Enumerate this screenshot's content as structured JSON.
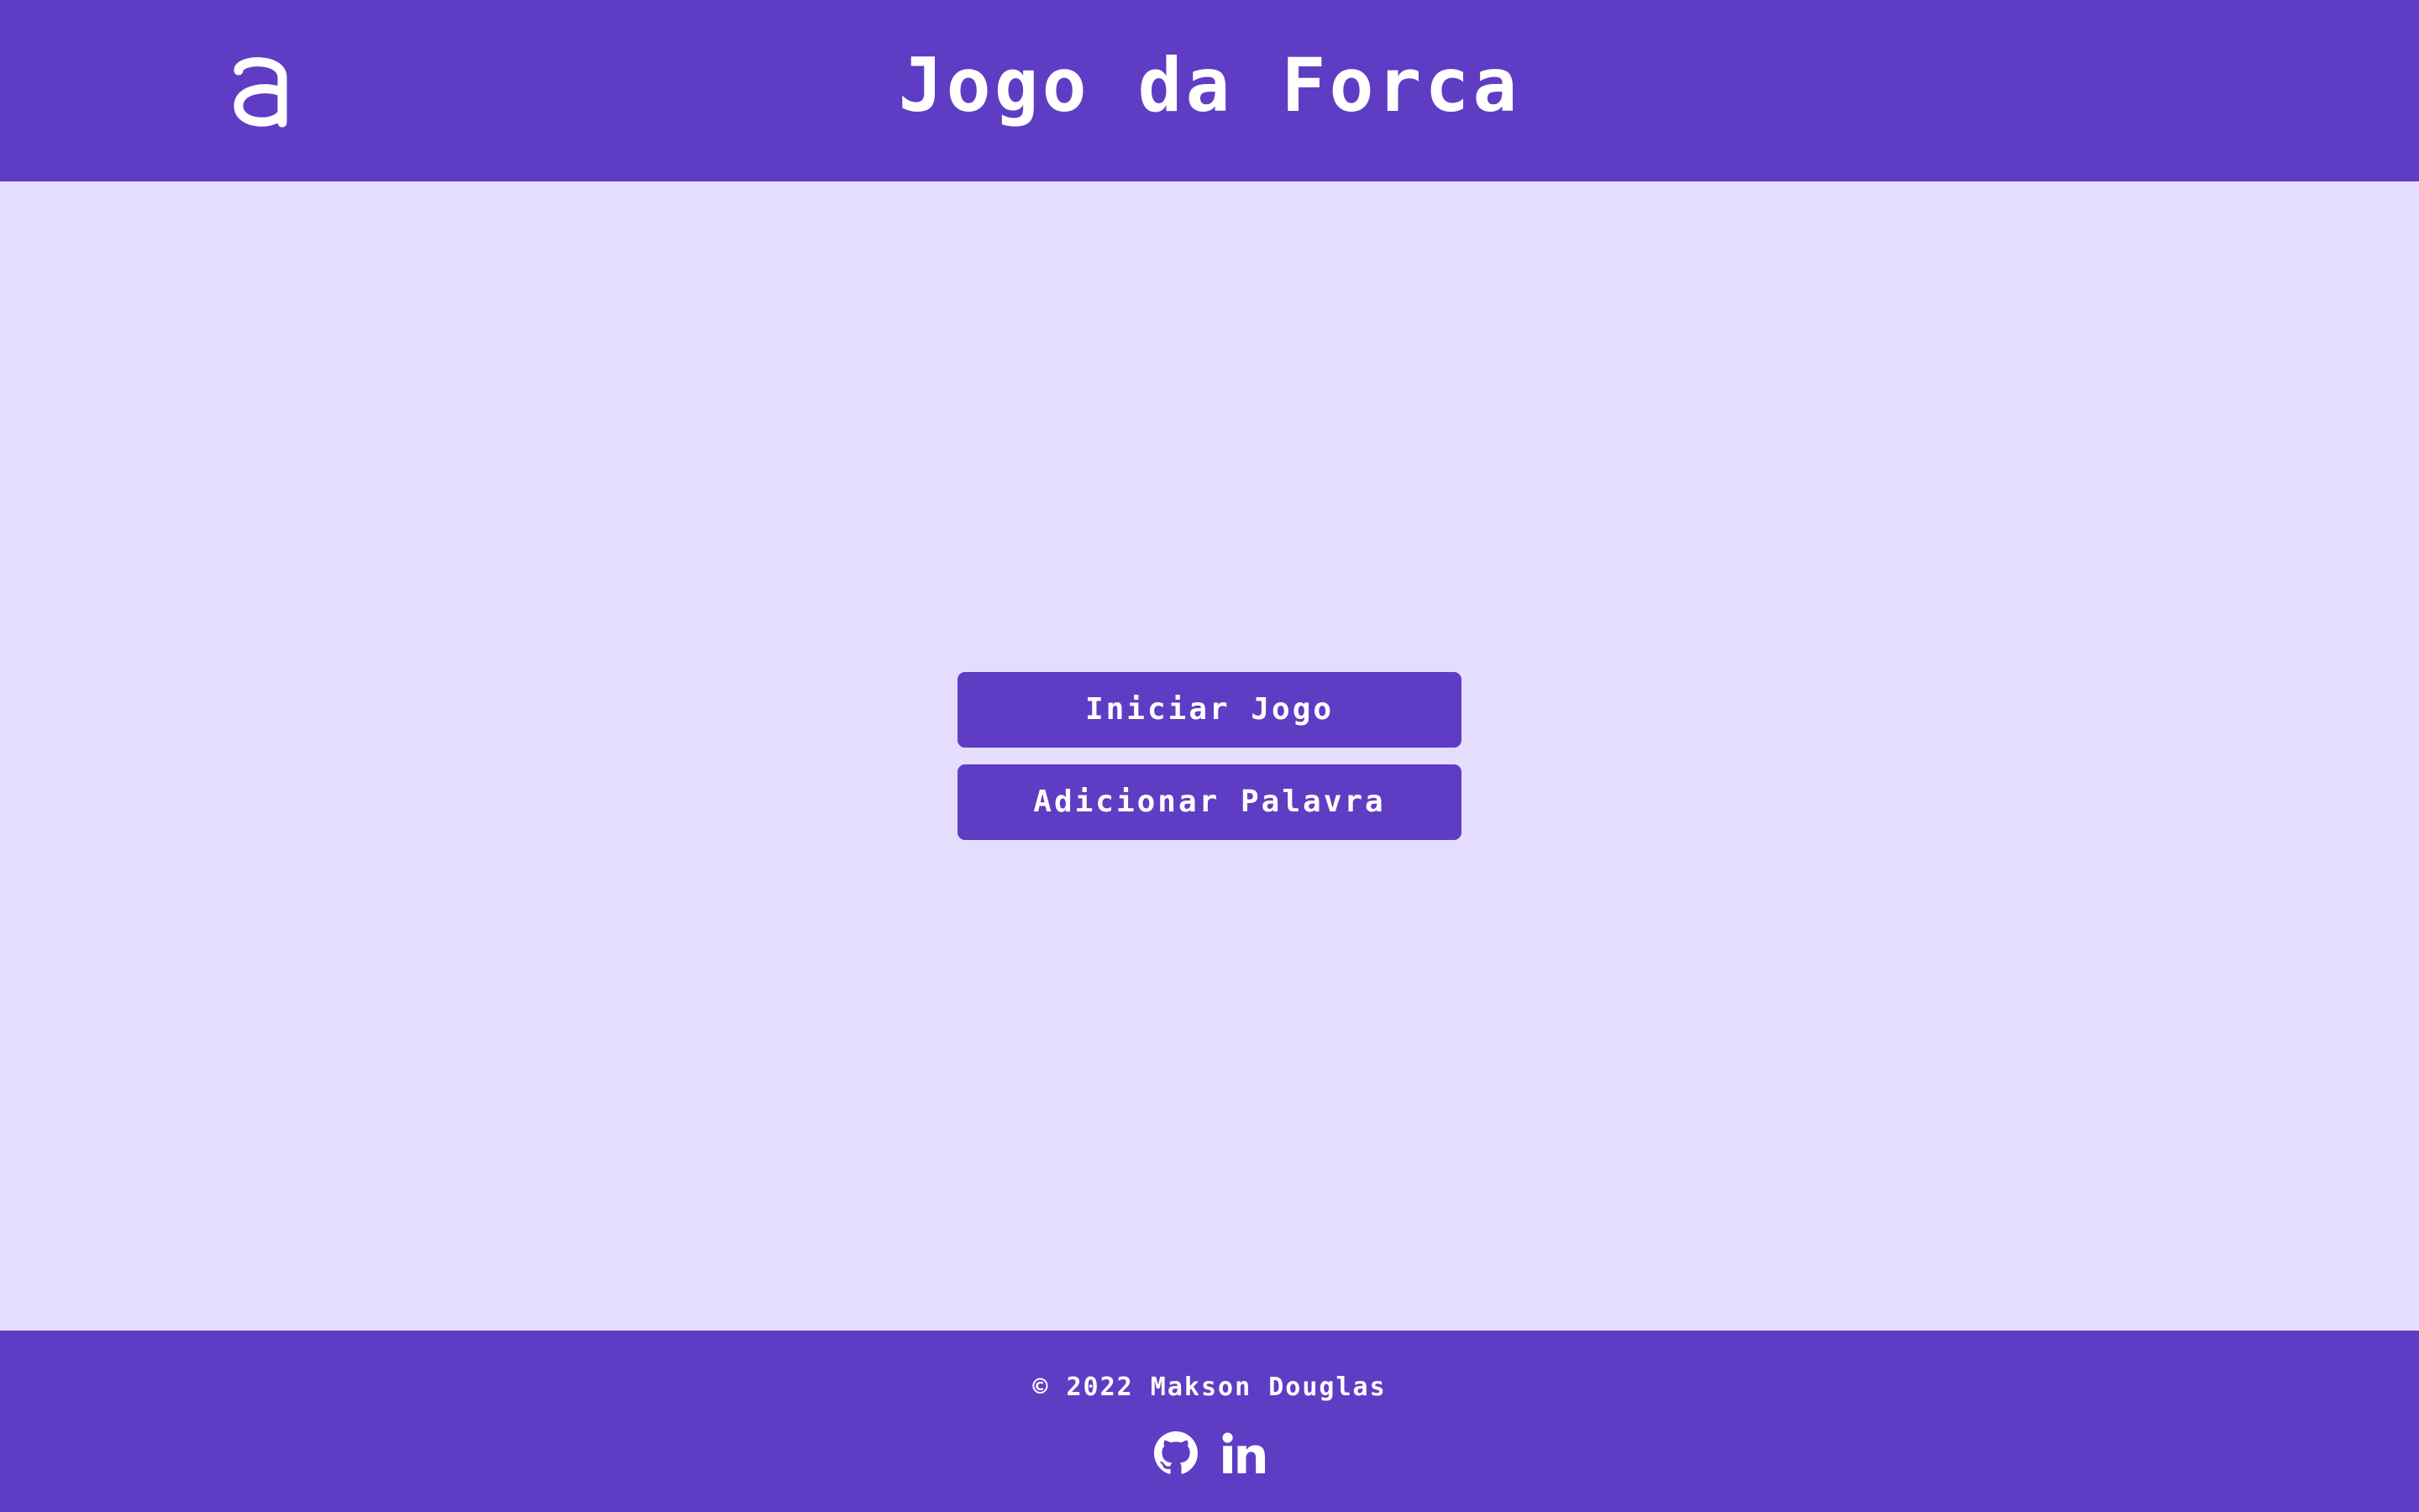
{
  "header": {
    "logo_icon": "alura-a-logo",
    "title": "Jogo da Forca"
  },
  "main": {
    "start_button_label": "Iniciar Jogo",
    "add_word_button_label": "Adicionar Palavra"
  },
  "footer": {
    "copyright": "© 2022 Makson Douglas",
    "social_icons": [
      "github-icon",
      "linkedin-icon"
    ]
  },
  "colors": {
    "primary": "#5E3DC4",
    "background": "#E5DDFD",
    "text_on_primary": "#FFFFFF"
  }
}
